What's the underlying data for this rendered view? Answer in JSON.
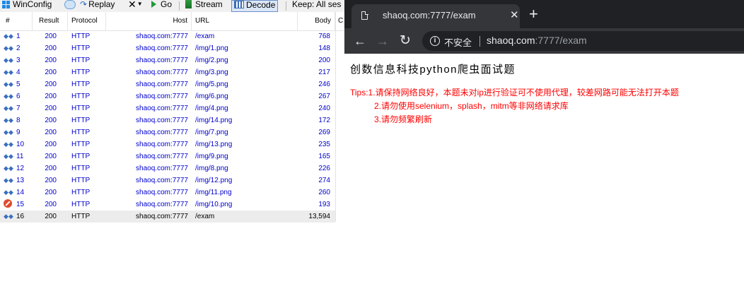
{
  "fiddler": {
    "toolbar": {
      "winconfig": "WinConfig",
      "replay": "Replay",
      "go": "Go",
      "stream": "Stream",
      "decode": "Decode",
      "keep": "Keep: All ses"
    },
    "columns": [
      "#",
      "Result",
      "Protocol",
      "Host",
      "URL",
      "Body",
      "C"
    ],
    "sessions": [
      {
        "num": "1",
        "result": "200",
        "protocol": "HTTP",
        "host": "shaoq.com:7777",
        "url": "/exam",
        "body": "768",
        "icon": "request-response-icon"
      },
      {
        "num": "2",
        "result": "200",
        "protocol": "HTTP",
        "host": "shaoq.com:7777",
        "url": "/img/1.png",
        "body": "148",
        "icon": "request-response-icon"
      },
      {
        "num": "3",
        "result": "200",
        "protocol": "HTTP",
        "host": "shaoq.com:7777",
        "url": "/img/2.png",
        "body": "200",
        "icon": "request-response-icon"
      },
      {
        "num": "4",
        "result": "200",
        "protocol": "HTTP",
        "host": "shaoq.com:7777",
        "url": "/img/3.png",
        "body": "217",
        "icon": "request-response-icon"
      },
      {
        "num": "5",
        "result": "200",
        "protocol": "HTTP",
        "host": "shaoq.com:7777",
        "url": "/img/5.png",
        "body": "246",
        "icon": "request-response-icon"
      },
      {
        "num": "6",
        "result": "200",
        "protocol": "HTTP",
        "host": "shaoq.com:7777",
        "url": "/img/6.png",
        "body": "267",
        "icon": "request-response-icon"
      },
      {
        "num": "7",
        "result": "200",
        "protocol": "HTTP",
        "host": "shaoq.com:7777",
        "url": "/img/4.png",
        "body": "240",
        "icon": "request-response-icon"
      },
      {
        "num": "8",
        "result": "200",
        "protocol": "HTTP",
        "host": "shaoq.com:7777",
        "url": "/img/14.png",
        "body": "172",
        "icon": "request-response-icon"
      },
      {
        "num": "9",
        "result": "200",
        "protocol": "HTTP",
        "host": "shaoq.com:7777",
        "url": "/img/7.png",
        "body": "269",
        "icon": "request-response-icon"
      },
      {
        "num": "10",
        "result": "200",
        "protocol": "HTTP",
        "host": "shaoq.com:7777",
        "url": "/img/13.png",
        "body": "235",
        "icon": "request-response-icon"
      },
      {
        "num": "11",
        "result": "200",
        "protocol": "HTTP",
        "host": "shaoq.com:7777",
        "url": "/img/9.png",
        "body": "165",
        "icon": "request-response-icon"
      },
      {
        "num": "12",
        "result": "200",
        "protocol": "HTTP",
        "host": "shaoq.com:7777",
        "url": "/img/8.png",
        "body": "226",
        "icon": "request-response-icon"
      },
      {
        "num": "13",
        "result": "200",
        "protocol": "HTTP",
        "host": "shaoq.com:7777",
        "url": "/img/12.png",
        "body": "274",
        "icon": "request-response-icon"
      },
      {
        "num": "14",
        "result": "200",
        "protocol": "HTTP",
        "host": "shaoq.com:7777",
        "url": "/img/11.png",
        "body": "260",
        "icon": "request-response-icon"
      },
      {
        "num": "15",
        "result": "200",
        "protocol": "HTTP",
        "host": "shaoq.com:7777",
        "url": "/img/10.png",
        "body": "193",
        "icon": "blocked-icon"
      },
      {
        "num": "16",
        "result": "200",
        "protocol": "HTTP",
        "host": "shaoq.com:7777",
        "url": "/exam",
        "body": "13,594",
        "icon": "request-response-icon",
        "selected": true
      }
    ]
  },
  "browser": {
    "tab_title": "shaoq.com:7777/exam",
    "omnibox": {
      "security_label": "不安全",
      "url_host": "shaoq.com",
      "url_rest": ":7777/exam"
    },
    "page": {
      "heading": "创数信息科技python爬虫面试题",
      "tips": [
        "Tips:1.请保持网络良好，本题未对ip进行验证可不使用代理，较差网路可能无法打开本题",
        "2.请勿使用selenium，splash，mitm等非网络请求库",
        "3.请勿频繁刷新"
      ]
    }
  },
  "colors": {
    "fiddler_row_text": "#0000cc",
    "chrome_dark": "#202124",
    "chrome_toolbar": "#35363a",
    "tip_red": "#ff0000"
  }
}
